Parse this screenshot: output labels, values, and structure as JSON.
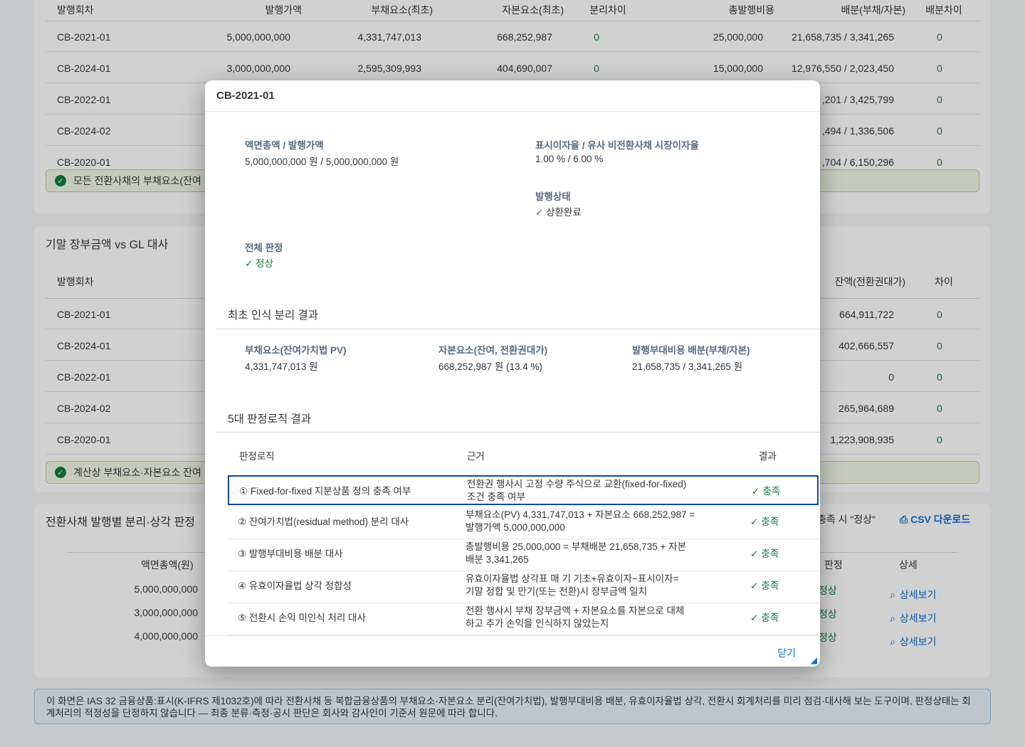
{
  "top_table": {
    "headers": [
      "발행회차",
      "발행가액",
      "부채요소(최초)",
      "자본요소(최초)",
      "분리차이",
      "총발행비용",
      "배분(부채/자본)",
      "배분차이"
    ],
    "rows": [
      [
        "CB-2021-01",
        "5,000,000,000",
        "4,331,747,013",
        "668,252,987",
        "0",
        "25,000,000",
        "21,658,735 / 3,341,265",
        "0"
      ],
      [
        "CB-2024-01",
        "3,000,000,000",
        "2,595,309,993",
        "404,690,007",
        "0",
        "15,000,000",
        "12,976,550 / 2,023,450",
        "0"
      ],
      [
        "CB-2022-01",
        "",
        "",
        "",
        "",
        "",
        ",201 / 3,425,799",
        "0"
      ],
      [
        "CB-2024-02",
        "",
        "",
        "",
        "",
        "",
        ",494 / 1,336,506",
        "0"
      ],
      [
        "CB-2020-01",
        "",
        "",
        "",
        "",
        "",
        ",704 / 6,150,296",
        "0"
      ]
    ],
    "banner": "모든 전환사채의 부채요소(잔여"
  },
  "gl_panel": {
    "title": "기말 장부금액 vs GL 대사",
    "headers": [
      "발행회차",
      "잔액(전환권대가)",
      "차이"
    ],
    "rows": [
      [
        "CB-2021-01",
        "664,911,722",
        "0"
      ],
      [
        "CB-2024-01",
        "402,666,557",
        "0"
      ],
      [
        "CB-2022-01",
        "0",
        "0"
      ],
      [
        "CB-2024-02",
        "265,964,689",
        "0"
      ],
      [
        "CB-2020-01",
        "1,223,908,935",
        "0"
      ]
    ],
    "banner": "계산상 부채요소·자본요소 잔여"
  },
  "issue_panel": {
    "title": "전환사채 발행별 분리·상각 판정",
    "hint": "충족 시 \"정상\"",
    "csv_label": "CSV 다운로드",
    "headers": [
      "액면총액(원)",
      "판정",
      "상세"
    ],
    "rows": [
      [
        "5,000,000,000",
        "정상",
        "상세보기"
      ],
      [
        "3,000,000,000",
        "정상",
        "상세보기"
      ],
      [
        "4,000,000,000",
        "정상",
        "상세보기"
      ]
    ]
  },
  "footer_note": "이 화면은 IAS 32 금융상품:표시(K-IFRS 제1032호)에 따라 전환사채 등 복합금융상품의 부채요소·자본요소 분리(잔여가치법), 발행부대비용 배분, 유효이자율법 상각, 전환시 회계처리를 미리 점검·대사해 보는 도구이며, 판정상태는 회계처리의 적정성을 단정하지 않습니다 — 최종 분류·측정·공시 판단은 회사와 감사인이 기준서 원문에 따라 합니다.",
  "dialog": {
    "title": "CB-2021-01",
    "info": {
      "face_label": "액면총액 / 발행가액",
      "face_value": "5,000,000,000 원 / 5,000,000,000 원",
      "rate_label": "표시이자율 / 유사 비전환사채 시장이자율",
      "rate_value": "1.00 % / 6.00 %",
      "status_label": "발행상태",
      "status_value": "상환완료",
      "overall_label": "전체 판정",
      "overall_value": "정상"
    },
    "split_section": {
      "title": "최초 인식 분리 결과",
      "liab_label": "부채요소(잔여가치법 PV)",
      "liab_value": "4,331,747,013 원",
      "equity_label": "자본요소(잔여, 전환권대가)",
      "equity_value": "668,252,987 원 (13.4 %)",
      "cost_label": "발행부대비용 배분(부채/자본)",
      "cost_value": "21,658,735 / 3,341,265 원"
    },
    "logic_section": {
      "title": "5대 판정로직 결과",
      "headers": [
        "판정로직",
        "근거",
        "결과"
      ],
      "rows": [
        {
          "logic": "① Fixed-for-fixed 지분상품 정의 충족 여부",
          "basis1": "전환권 행사시 고정 수량 주식으로 교환(fixed-for-fixed)",
          "basis2": "조건 충족 여부",
          "result": "충족"
        },
        {
          "logic": "② 잔여가치법(residual method) 분리 대사",
          "basis1": "부채요소(PV) 4,331,747,013 + 자본요소 668,252,987 =",
          "basis2": "발행가액 5,000,000,000",
          "result": "충족"
        },
        {
          "logic": "③ 발행부대비용 배분 대사",
          "basis1": "총발행비용 25,000,000 = 부채배분 21,658,735 + 자본",
          "basis2": "배분 3,341,265",
          "result": "충족"
        },
        {
          "logic": "④ 유효이자율법 상각 정합성",
          "basis1": "유효이자율법 상각표 매 기 기초+유효이자−표시이자=",
          "basis2": "기말 정합 및 만기(또는 전환)시 장부금액 일치",
          "result": "충족"
        },
        {
          "logic": "⑤ 전환시 손익 미인식 처리 대사",
          "basis1": "전환 행사시 부채 장부금액 + 자본요소를 자본으로 대체",
          "basis2": "하고 추가 손익을 인식하지 않았는지",
          "result": "충족"
        }
      ]
    },
    "close_label": "닫기"
  }
}
